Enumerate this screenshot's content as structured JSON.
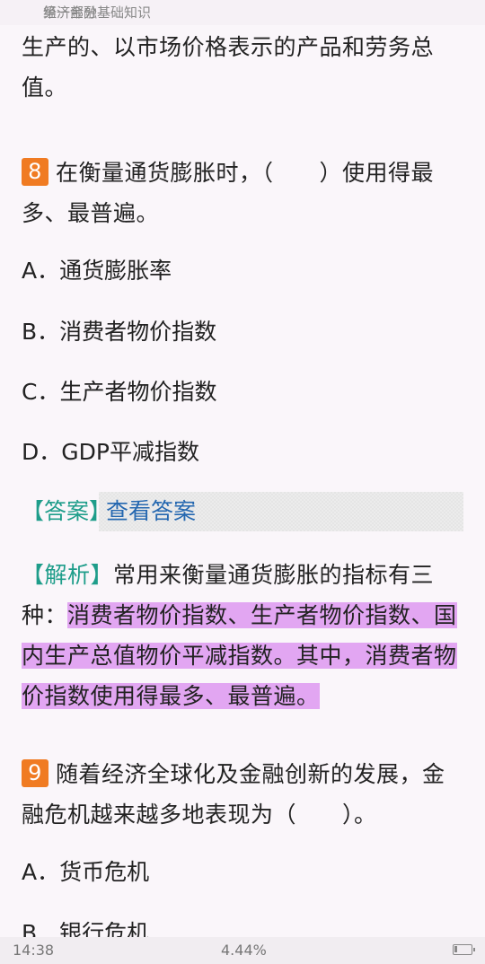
{
  "header": {
    "section": "第一部分",
    "title": "经济金融基础知识"
  },
  "prev": {
    "text": "生产的、以市场价格表示的产品和劳务总值。"
  },
  "q8": {
    "number": "8",
    "question": "在衡量通货膨胀时，（　　）使用得最多、最普遍。",
    "options": [
      "A．通货膨胀率",
      "B．消费者物价指数",
      "C．生产者物价指数",
      "D．GDP平减指数"
    ],
    "answer_tag": "【答案】",
    "answer_button": "查看答案",
    "analysis_tag": "【解析】",
    "analysis_plain": "常用来衡量通货膨胀的指标有三种：",
    "analysis_highlight": "消费者物价指数、生产者物价指数、国内生产总值物价平减指数。其中，消费者物价指数使用得最多、最普遍。"
  },
  "q9": {
    "number": "9",
    "question": "随着经济全球化及金融创新的发展，金融危机越来越多地表现为（　　）。",
    "options": [
      "A．货币危机",
      "B．银行危机"
    ]
  },
  "status": {
    "time": "14:38",
    "progress": "4.44%"
  },
  "colors": {
    "number_badge": "#f07b22",
    "tag": "#1e9d8a",
    "link": "#2467b0",
    "highlight": "#e2a6f2"
  }
}
